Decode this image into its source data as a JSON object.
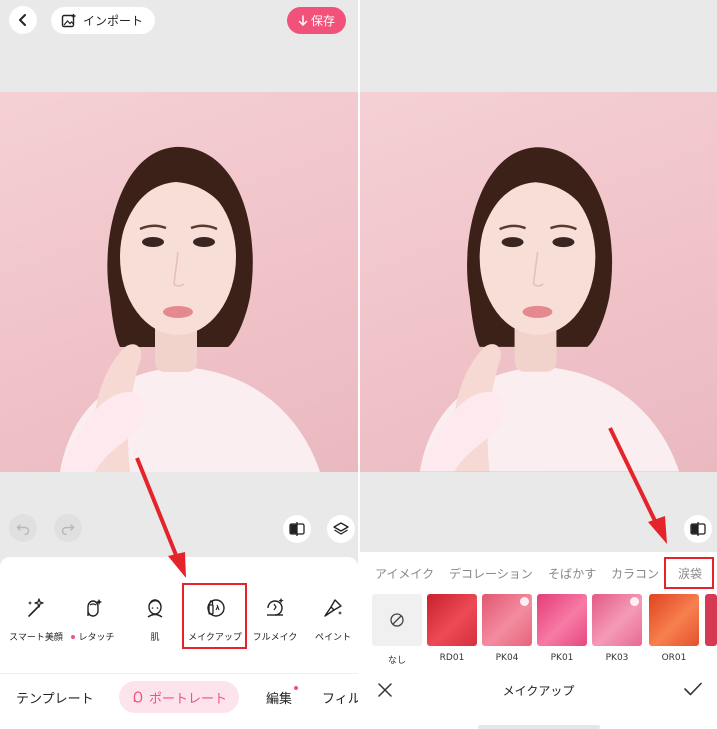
{
  "left": {
    "topbar": {
      "import_label": "インポート",
      "save_label": "保存"
    },
    "tools": [
      {
        "label": "スマート美顔",
        "icon": "magic-wand-icon",
        "dot": false
      },
      {
        "label": "レタッチ",
        "icon": "face-retouch-icon",
        "dot": true
      },
      {
        "label": "肌",
        "icon": "face-skin-icon",
        "dot": false
      },
      {
        "label": "メイクアップ",
        "icon": "lipstick-icon",
        "dot": false
      },
      {
        "label": "フルメイク",
        "icon": "full-makeup-icon",
        "dot": false
      },
      {
        "label": "ペイント",
        "icon": "brush-icon",
        "dot": false
      }
    ],
    "bottom_tabs": [
      {
        "label": "テンプレート"
      },
      {
        "label": "ポートレート"
      },
      {
        "label": "編集"
      },
      {
        "label": "フィル"
      }
    ]
  },
  "right": {
    "categories": [
      {
        "label": "アイメイク"
      },
      {
        "label": "デコレーション"
      },
      {
        "label": "そばかす"
      },
      {
        "label": "カラコン"
      },
      {
        "label": "涙袋"
      }
    ],
    "swatches": [
      {
        "label": "なし",
        "color": "#f0f0f0"
      },
      {
        "label": "RD01",
        "color": "#e3343f"
      },
      {
        "label": "PK04",
        "color": "#ef6f86"
      },
      {
        "label": "PK01",
        "color": "#f0598c"
      },
      {
        "label": "PK03",
        "color": "#ee7597"
      },
      {
        "label": "OR01",
        "color": "#ef5a3a"
      },
      {
        "label": "",
        "color": "#d63a52"
      }
    ],
    "panel_title": "メイクアップ"
  },
  "colors": {
    "accent": "#f0527a",
    "annotation": "#e4242a"
  }
}
